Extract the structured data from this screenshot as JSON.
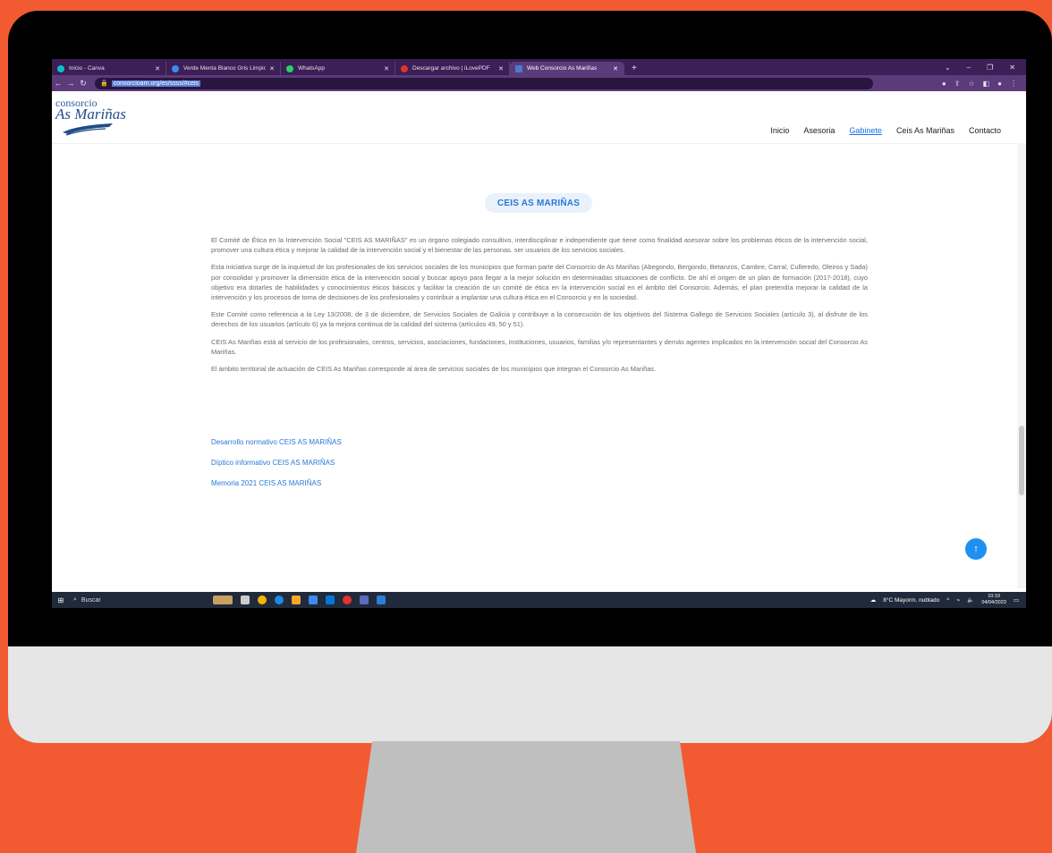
{
  "browser": {
    "tabs": [
      {
        "title": "Inicio - Canva",
        "color": "#00c4cc"
      },
      {
        "title": "Verde Menta Blanco Gris Limpio",
        "color": "#3d8bf0"
      },
      {
        "title": "WhatsApp",
        "color": "#25d366"
      },
      {
        "title": "Descargar archivo | iLovePDF",
        "color": "#e5322d"
      },
      {
        "title": "Web Consorcio As Mariñas",
        "color": "#4a7bd0"
      }
    ],
    "url": "consorcioam.org/es/ssss/#ceis"
  },
  "site": {
    "logo_top": "consorcio",
    "logo_main": "As Mariñas",
    "nav": [
      "Inicio",
      "Asesoria",
      "Gabinete",
      "Ceis As Mariñas",
      "Contacto"
    ],
    "nav_current": "Gabinete"
  },
  "main": {
    "heading": "CEIS AS MARIÑAS",
    "paragraphs": [
      "El Comité de Ética en la Intervención Social \"CEIS AS MARIÑAS\" es un órgano colegiado consultivo, interdisciplinar e independiente que tiene como finalidad asesorar sobre los problemas éticos de la intervención social, promover una cultura ética y mejorar la calidad de la intervención social y el bienestar de las personas. ser usuarios de los servicios sociales.",
      "Esta iniciativa surge de la inquietud de los profesionales de los servicios sociales de los municipios que forman parte del Consorcio de As Mariñas (Abegondo, Bergondo, Betanzos, Cambre, Carral, Culleredo, Oleiros y Sada) por consolidar y promover la dimensión ética de la intervención social y buscar apoyo para llegar a la mejor solución en determinadas situaciones de conflicto. De ahí el origen de un plan de formación (2017-2018), cuyo objetivo era dotarles de habilidades y conocimientos éticos básicos y facilitar la creación de un comité de ética en la intervención social en el ámbito del Consorcio. Además, el plan pretendía mejorar la calidad de la intervención y los procesos de toma de decisiones de los profesionales y contribuir a implantar una cultura ética en el Consorcio y en la sociedad.",
      "Este Comité como referencia a la Ley 13/2008, de 3 de diciembre, de Servicios Sociales de Galicia y contribuye a la consecución de los objetivos del Sistema Gallego de Servicios Sociales (artículo 3), al disfrute de los derechos de los usuarios (artículo 6) ya la mejora continua de la calidad del sistema (artículos 49, 50 y 51).",
      "CEIS As Mariñas está al servicio de los profesionales, centros, servicios, asociaciones, fundaciones, instituciones, usuarios, familias y/o representantes y demás agentes implicados en la intervención social del Consorcio As Mariñas.",
      "El ámbito territorial de actuación de CEIS As Mariñas corresponde al área de servicios sociales de los municipios que integran el Consorcio As Mariñas."
    ],
    "links": [
      "Desarrollo normativo CEIS AS MARIÑAS",
      "Díptico informativo CEIS AS MARIÑAS",
      "Memoria  2021 CEIS AS MARIÑAS"
    ],
    "to_top_icon": "arrow-up-icon"
  },
  "taskbar": {
    "search_label": "Buscar",
    "weather": "8°C  Mayorm. nublado",
    "time": "10:19",
    "date": "04/04/2023",
    "app_colors": [
      "#c8a060",
      "#cccccc",
      "#f4b400",
      "#1e88e5",
      "#f9a825",
      "#3d8bf0",
      "#0078d4",
      "#e5322d",
      "#5c6bc0",
      "#2e7dd7"
    ]
  }
}
